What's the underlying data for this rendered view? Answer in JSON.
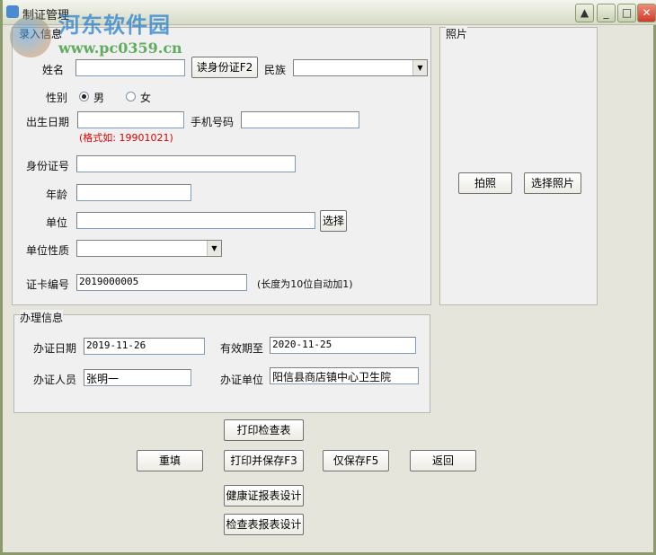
{
  "window": {
    "title": "制证管理",
    "controls": [
      "up",
      "minimize",
      "maximize",
      "close"
    ]
  },
  "watermark": {
    "name": "河东软件园",
    "url": "www.pc0359.cn"
  },
  "entry": {
    "legend": "录入信息",
    "name_label": "姓名",
    "name_value": "",
    "read_id_button": "读身份证F2",
    "ethnic_label": "民族",
    "ethnic_value": "",
    "gender_label": "性别",
    "gender_male": "男",
    "gender_female": "女",
    "gender_selected": "male",
    "birth_label": "出生日期",
    "birth_value": "",
    "phone_label": "手机号码",
    "phone_value": "",
    "birth_hint": "(格式如: 19901021)",
    "id_label": "身份证号",
    "id_value": "",
    "age_label": "年龄",
    "age_value": "",
    "unit_label": "单位",
    "unit_value": "",
    "unit_select_button": "选择",
    "unit_type_label": "单位性质",
    "unit_type_value": "",
    "card_no_label": "证卡编号",
    "card_no_value": "2019000005",
    "card_no_hint": "(长度为10位自动加1)"
  },
  "photo": {
    "legend": "照片",
    "take_button": "拍照",
    "choose_button": "选择照片"
  },
  "process": {
    "legend": "办理信息",
    "date_label": "办证日期",
    "date_value": "2019-11-26",
    "valid_label": "有效期至",
    "valid_value": "2020-11-25",
    "person_label": "办证人员",
    "person_value": "张明一",
    "unit_label": "办证单位",
    "unit_value": "阳信县商店镇中心卫生院"
  },
  "buttons": {
    "print_check": "打印检查表",
    "reset": "重填",
    "print_save": "打印并保存F3",
    "save_only": "仅保存F5",
    "back": "返回",
    "health_design": "健康证报表设计",
    "check_design": "检查表报表设计"
  }
}
